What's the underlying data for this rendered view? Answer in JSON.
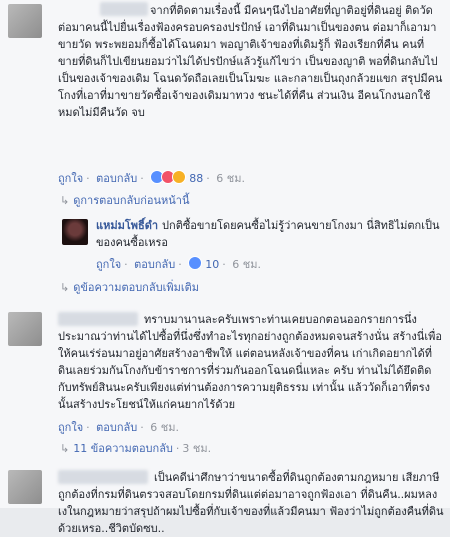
{
  "comment1": {
    "text": "จากที่ติดตามเรื่องนี้ มีคนๆนึงไปอาศัยที่ญาติอยู่ที่ดินอยู่ ติดวัด ต่อมาคนนี้ไปยื่นเรื่องฟ้องครอบครองปรปักษ์ เอาที่ดินมาเป็นของตน ต่อมาก็เอามาขายวัด พระพยอมก็ซื้อได้โฉนดมา พอญาติเจ้าของที่เดิมรู้ก็ ฟ้องเรียกที่คืน คนที่ขายที่ดินก็ไปเขียนยอมว่าไม่ได้ปรปักษ์แล้วรู้แก้ไขว่า เป็นของญาติ พอที่ดินกลับไปเป็นของเจ้าของเดิม โฉนดวัดถือเลยเป็นโมฆะ และกลายเป็นถุงกล้วยแขก สรุปมีคนโกงที่เอาที่มาขายวัดซื้อเจ้าของเดิมมาทวง ชนะได้ที่คืน ส่วนเงิน อีคนโกงนอกใช้หมดไม่มีคืนวัด จบ",
    "like": "ถูกใจ",
    "reply": "ตอบกลับ",
    "reactions": "88",
    "time": "6 ชม."
  },
  "see_previous": "ดูการตอบกลับก่อนหน้านี้",
  "reply1": {
    "name": "แหม่มโพธิ์ดำ",
    "text": "ปกติซื้อขายโดยคนซื้อไม่รู้ว่าคนขายโกงมา นี่สิทธิไม่ตกเป็นของคนซื้อเหรอ",
    "like": "ถูกใจ",
    "reply": "ตอบกลับ",
    "reactions": "10",
    "time": "6 ชม."
  },
  "see_more": "ดูข้อความตอบกลับเพิ่มเติม",
  "comment2": {
    "text": "ทราบมานานละครับเพราะท่านเคยบอกตอนออกรายการนึ่ง ประมาณว่าท่านได้ไปซื้อที่นึ่งซึ่งทำอะไรทุกอย่างถูกต้องหมดจนสร้างนั่น สร้างนี่เพื่อให้คนเร่ร่อนมาอยู่อาศัยสร้างอาชีพให้ แต่ตอนหลังเจ้าของที่คน เก่าเกิดอยากได้ที่ดินเลยร่วมกันโกงกับข้าราชการที่ร่วมกันออกโฉนดนี่แหละ ครับ ท่านไม่ได้ยึดติดกับทรัพย์สินนะครับเพียงแต่ท่านต้องการความยุติธรรม เท่านั้น แล้ววัดก็เอาที่ตรงนั้นสร้างประโยชน์ให้แก่คนยากไร้ด้วย",
    "like": "ถูกใจ",
    "reply": "ตอบกลับ",
    "time": "6 ชม."
  },
  "replies_count": "11 ข้อความตอบกลับ",
  "replies_time": "3 ชม.",
  "comment3": {
    "text": "เป็นคดีน่าศึกษาว่าขนาดซื้อที่ดินถูกต้องตามกฎหมาย เสียภาษีถูกต้องที่กรมที่ดินตรวจสอบโดยกรมที่ดินแต่ต่อมาอาจถูกฟ้องเอา ที่ดินคืน..ผมหลงเงในกฎหมายว่าสรุปถ้าผมไปซื้อที่กับเจ้าของที่แล้วมีคนมา ฟ้องว่าไม่ถูกต้องคืนที่ดินด้วยเหรอ..ชีวิตบัดซบ.."
  },
  "colors": {
    "link": "#4267b2",
    "name": "#365899",
    "meta": "#90949c",
    "background": "#f6f7f9"
  }
}
